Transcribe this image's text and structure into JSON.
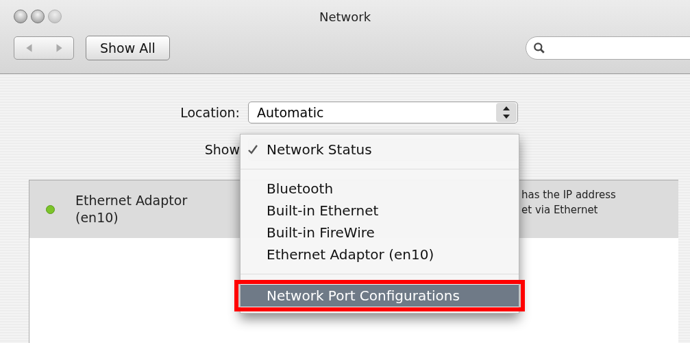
{
  "window": {
    "title": "Network"
  },
  "toolbar": {
    "show_all": "Show All"
  },
  "location": {
    "label": "Location:",
    "value": "Automatic"
  },
  "show": {
    "label": "Show"
  },
  "services": [
    {
      "name": "Ethernet Adaptor (en10)",
      "color": "#7cc42a",
      "selected": true
    }
  ],
  "status_lines": [
    "has the IP address",
    "et via Ethernet"
  ],
  "menu": {
    "items": [
      {
        "kind": "item",
        "label": "Network Status",
        "checked": true,
        "selected": false,
        "outlined": false
      },
      {
        "kind": "separator"
      },
      {
        "kind": "item",
        "label": "Bluetooth",
        "checked": false,
        "selected": false,
        "outlined": false
      },
      {
        "kind": "item",
        "label": "Built-in Ethernet",
        "checked": false,
        "selected": false,
        "outlined": false
      },
      {
        "kind": "item",
        "label": "Built-in FireWire",
        "checked": false,
        "selected": false,
        "outlined": false
      },
      {
        "kind": "item",
        "label": "Ethernet Adaptor (en10)",
        "checked": false,
        "selected": false,
        "outlined": false
      },
      {
        "kind": "separator"
      },
      {
        "kind": "item",
        "label": "Network Port Configurations",
        "checked": false,
        "selected": true,
        "outlined": true
      }
    ]
  }
}
